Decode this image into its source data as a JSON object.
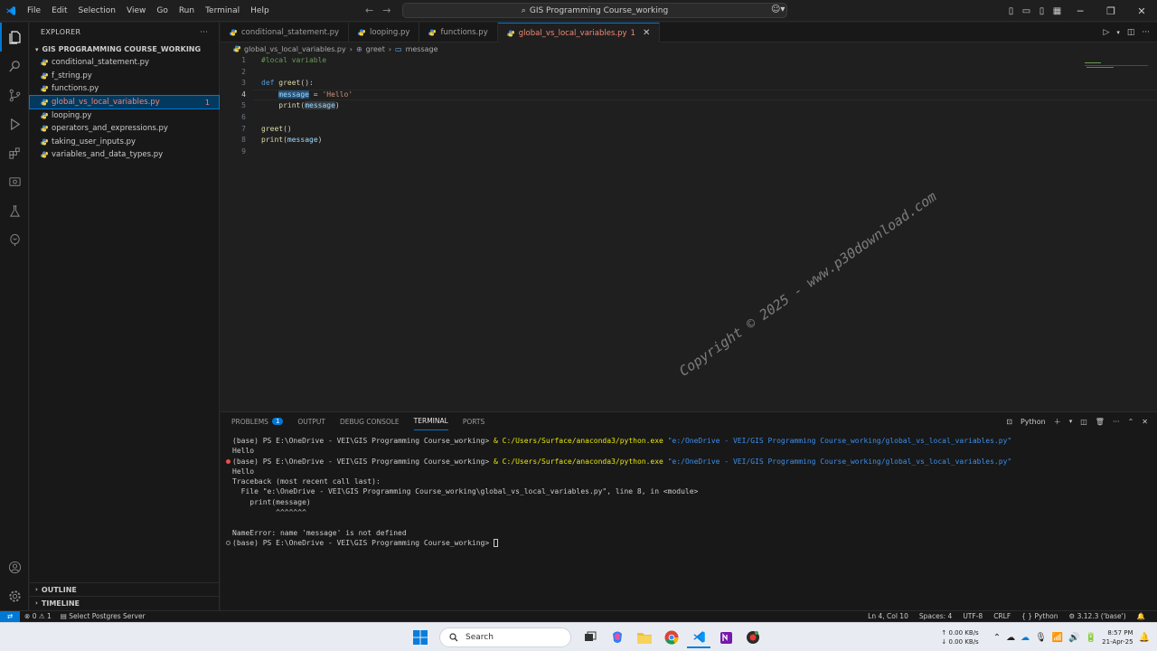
{
  "window": {
    "search_title": "GIS Programming Course_working"
  },
  "menu": [
    "File",
    "Edit",
    "Selection",
    "View",
    "Go",
    "Run",
    "Terminal",
    "Help"
  ],
  "sidebar": {
    "header": "EXPLORER",
    "folder": "GIS PROGRAMMING COURSE_WORKING",
    "files": [
      {
        "name": "conditional_statement.py",
        "badge": ""
      },
      {
        "name": "f_string.py",
        "badge": ""
      },
      {
        "name": "functions.py",
        "badge": ""
      },
      {
        "name": "global_vs_local_variables.py",
        "badge": "1"
      },
      {
        "name": "looping.py",
        "badge": ""
      },
      {
        "name": "operators_and_expressions.py",
        "badge": ""
      },
      {
        "name": "taking_user_inputs.py",
        "badge": ""
      },
      {
        "name": "variables_and_data_types.py",
        "badge": ""
      }
    ],
    "outline": "OUTLINE",
    "timeline": "TIMELINE"
  },
  "tabs": [
    {
      "label": "conditional_statement.py",
      "badge": "",
      "active": false
    },
    {
      "label": "looping.py",
      "badge": "",
      "active": false
    },
    {
      "label": "functions.py",
      "badge": "",
      "active": false
    },
    {
      "label": "global_vs_local_variables.py",
      "badge": "1",
      "active": true
    }
  ],
  "breadcrumb": {
    "file": "global_vs_local_variables.py",
    "func": "greet",
    "var": "message"
  },
  "editor": {
    "line_numbers": [
      "1",
      "2",
      "3",
      "4",
      "5",
      "6",
      "7",
      "8",
      "9"
    ],
    "current_line": "4",
    "watermark": "Copyright © 2025 - www.p30download.com"
  },
  "panel": {
    "tabs": {
      "problems": "PROBLEMS",
      "problems_count": "1",
      "output": "OUTPUT",
      "debug_console": "DEBUG CONSOLE",
      "terminal": "TERMINAL",
      "ports": "PORTS"
    },
    "shell_label": "Python",
    "terminal": {
      "prompt": "(base) PS E:\\OneDrive - VEI\\GIS Programming Course_working>",
      "amp": "&",
      "exe": "C:/Users/Surface/anaconda3/python.exe",
      "arg": "\"e:/OneDrive - VEI/GIS Programming Course_working/global_vs_local_variables.py\"",
      "out1": "Hello",
      "out2": "Hello",
      "tb1": "Traceback (most recent call last):",
      "tb2": "  File \"e:\\OneDrive - VEI\\GIS Programming Course_working\\global_vs_local_variables.py\", line 8, in <module>",
      "tb3": "    print(message)",
      "tb4": "          ^^^^^^^",
      "err": "NameError: name 'message' is not defined"
    }
  },
  "statusbar": {
    "errors": "0",
    "warnings": "1",
    "postgres": "Select Postgres Server",
    "position": "Ln 4, Col 10",
    "spaces": "Spaces: 4",
    "encoding": "UTF-8",
    "eol": "CRLF",
    "language": "Python",
    "interpreter": "3.12.3 ('base')"
  },
  "taskbar": {
    "search": "Search",
    "net_up": "0.00 KB/s",
    "net_down": "0.00 KB/s",
    "time": "8:57 PM",
    "date": "21-Apr-25"
  },
  "colors": {
    "accent": "#0078d4",
    "editor_bg": "#1f1f1f",
    "sidebar_bg": "#181818"
  }
}
